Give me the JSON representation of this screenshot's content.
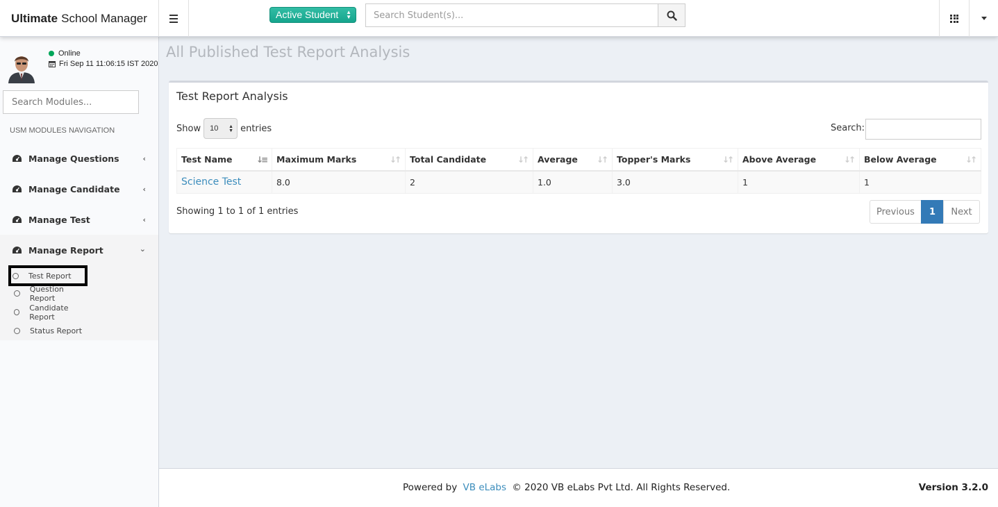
{
  "app": {
    "title_bold": "Ultimate",
    "title_rest": "School Manager"
  },
  "topbar": {
    "status_select": "Active Student",
    "search_placeholder": "Search Student(s)..."
  },
  "user": {
    "status": "Online",
    "datetime": "Fri Sep 11 11:06:15 IST 2020"
  },
  "sidebar": {
    "search_placeholder": "Search Modules...",
    "nav_header": "USM MODULES NAVIGATION",
    "items": [
      {
        "label": "Manage Questions"
      },
      {
        "label": "Manage Candidate"
      },
      {
        "label": "Manage Test"
      },
      {
        "label": "Manage Report"
      }
    ],
    "report_sub": [
      {
        "label": "Test Report"
      },
      {
        "label": "Question Report"
      },
      {
        "label": "Candidate Report"
      },
      {
        "label": "Status Report"
      }
    ]
  },
  "page": {
    "title": "All Published Test Report Analysis"
  },
  "box": {
    "title": "Test Report Analysis",
    "show_label": "Show",
    "length_value": "10",
    "entries_label": "entries",
    "search_label": "Search:",
    "columns": [
      "Test Name",
      "Maximum Marks",
      "Total Candidate",
      "Average",
      "Topper's Marks",
      "Above Average",
      "Below Average"
    ],
    "rows": [
      [
        "Science Test",
        "8.0",
        "2",
        "1.0",
        "3.0",
        "1",
        "1"
      ]
    ],
    "info": "Showing 1 to 1 of 1 entries",
    "pagination": {
      "previous": "Previous",
      "current": "1",
      "next": "Next"
    }
  },
  "footer": {
    "powered_by": "Powered by",
    "company_link": "VB eLabs",
    "copyright": "© 2020 VB eLabs Pvt Ltd. All Rights Reserved.",
    "version": "Version 3.2.0"
  },
  "colors": {
    "accent": "#3c8dbc",
    "active_green": "#16a58d",
    "online": "#00a65a",
    "page_bg": "#ecf0f5"
  }
}
